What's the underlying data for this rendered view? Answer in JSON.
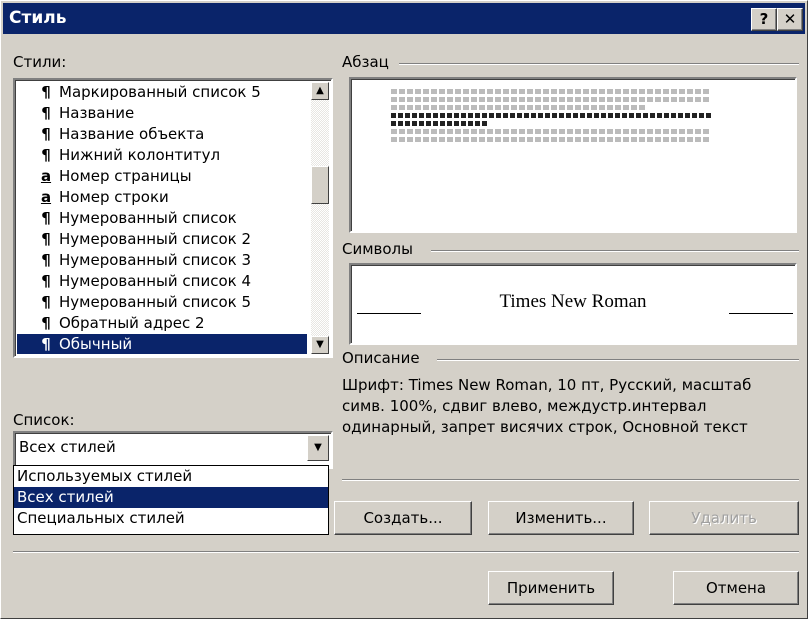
{
  "window": {
    "title": "Стиль",
    "help_label": "?",
    "close_label": "✕"
  },
  "styles_label": "Стили:",
  "styles_list": [
    {
      "icon": "¶",
      "label": "Маркированный список 5",
      "selected": false
    },
    {
      "icon": "¶",
      "label": "Название",
      "selected": false
    },
    {
      "icon": "¶",
      "label": "Название объекта",
      "selected": false
    },
    {
      "icon": "¶",
      "label": "Нижний колонтитул",
      "selected": false
    },
    {
      "icon": "a",
      "label": "Номер страницы",
      "selected": false
    },
    {
      "icon": "a",
      "label": "Номер строки",
      "selected": false
    },
    {
      "icon": "¶",
      "label": "Нумерованный список",
      "selected": false
    },
    {
      "icon": "¶",
      "label": "Нумерованный список 2",
      "selected": false
    },
    {
      "icon": "¶",
      "label": "Нумерованный список 3",
      "selected": false
    },
    {
      "icon": "¶",
      "label": "Нумерованный список 4",
      "selected": false
    },
    {
      "icon": "¶",
      "label": "Нумерованный список 5",
      "selected": false
    },
    {
      "icon": "¶",
      "label": "Обратный адрес 2",
      "selected": false
    },
    {
      "icon": "¶",
      "label": "Обычный",
      "selected": true
    }
  ],
  "paragraph_group_label": "Абзац",
  "characters_group_label": "Символы",
  "font_preview_text": "Times New Roman",
  "description_group_label": "Описание",
  "description_lines": [
    "Шрифт: Times New Roman, 10 пт, Русский, масштаб",
    "симв. 100%, сдвиг влево, междустр.интервал",
    "одинарный, запрет висячих строк, Основной текст"
  ],
  "list_label": "Список:",
  "list_combo_value": "Всех стилей",
  "list_options": [
    {
      "label": "Используемых стилей",
      "selected": false
    },
    {
      "label": "Всех стилей",
      "selected": true
    },
    {
      "label": "Специальных стилей",
      "selected": false
    }
  ],
  "buttons": {
    "create": "Создать...",
    "modify": "Изменить...",
    "delete": "Удалить",
    "apply": "Применить",
    "cancel": "Отмена"
  }
}
